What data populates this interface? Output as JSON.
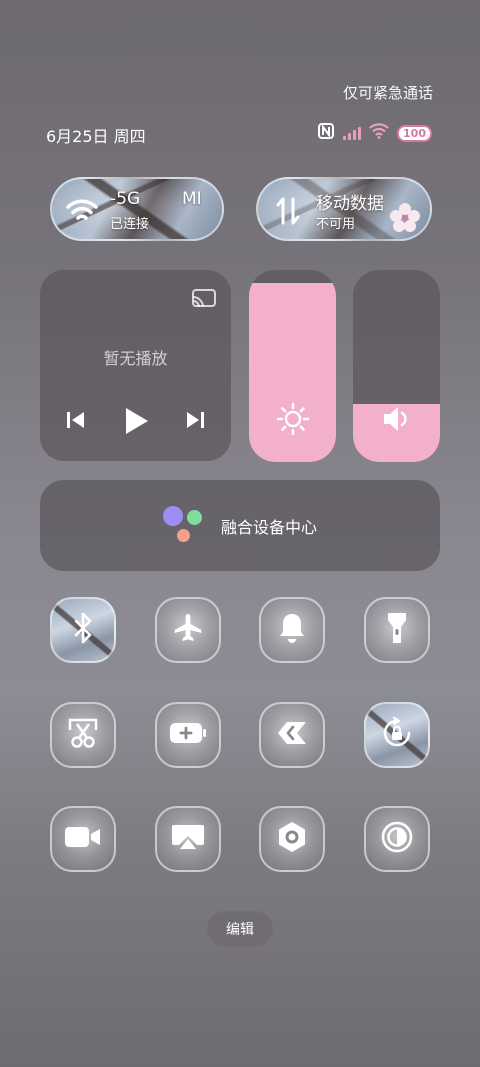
{
  "status_bar": {
    "emergency_text": "仅可紧急通话",
    "date_text": "6月25日 周四",
    "nfc_symbol": "N",
    "battery_level": "100",
    "accent_color": "#f3b0cc"
  },
  "wifi_tile": {
    "name": "-5G",
    "extra": "MI",
    "status": "已连接",
    "icon": "wifi-icon"
  },
  "mobile_data_tile": {
    "name": "移动数据",
    "status": "不可用",
    "icon": "data-arrows-icon"
  },
  "media": {
    "status_text": "暂无播放",
    "icons": [
      "cast-icon",
      "previous-icon",
      "play-icon",
      "next-icon"
    ]
  },
  "brightness_slider": {
    "level_fraction": 0.93,
    "icon": "sun-icon"
  },
  "volume_slider": {
    "level_fraction": 0.3,
    "icon": "speaker-icon"
  },
  "fusion_center": {
    "label": "融合设备中心"
  },
  "toggles": [
    {
      "icon": "bluetooth-icon",
      "active": true
    },
    {
      "icon": "airplane-icon",
      "active": false
    },
    {
      "icon": "bell-icon",
      "active": false
    },
    {
      "icon": "flashlight-icon",
      "active": false
    },
    {
      "icon": "screenshot-scissors-icon",
      "active": false
    },
    {
      "icon": "battery-saver-icon",
      "active": false
    },
    {
      "icon": "link-icon",
      "active": false
    },
    {
      "icon": "rotation-lock-icon",
      "active": true
    },
    {
      "icon": "video-camera-icon",
      "active": false
    },
    {
      "icon": "screen-cast-icon",
      "active": false
    },
    {
      "icon": "settings-hexagon-icon",
      "active": false
    },
    {
      "icon": "dark-mode-icon",
      "active": false
    }
  ],
  "edit_button": {
    "label": "编辑"
  }
}
